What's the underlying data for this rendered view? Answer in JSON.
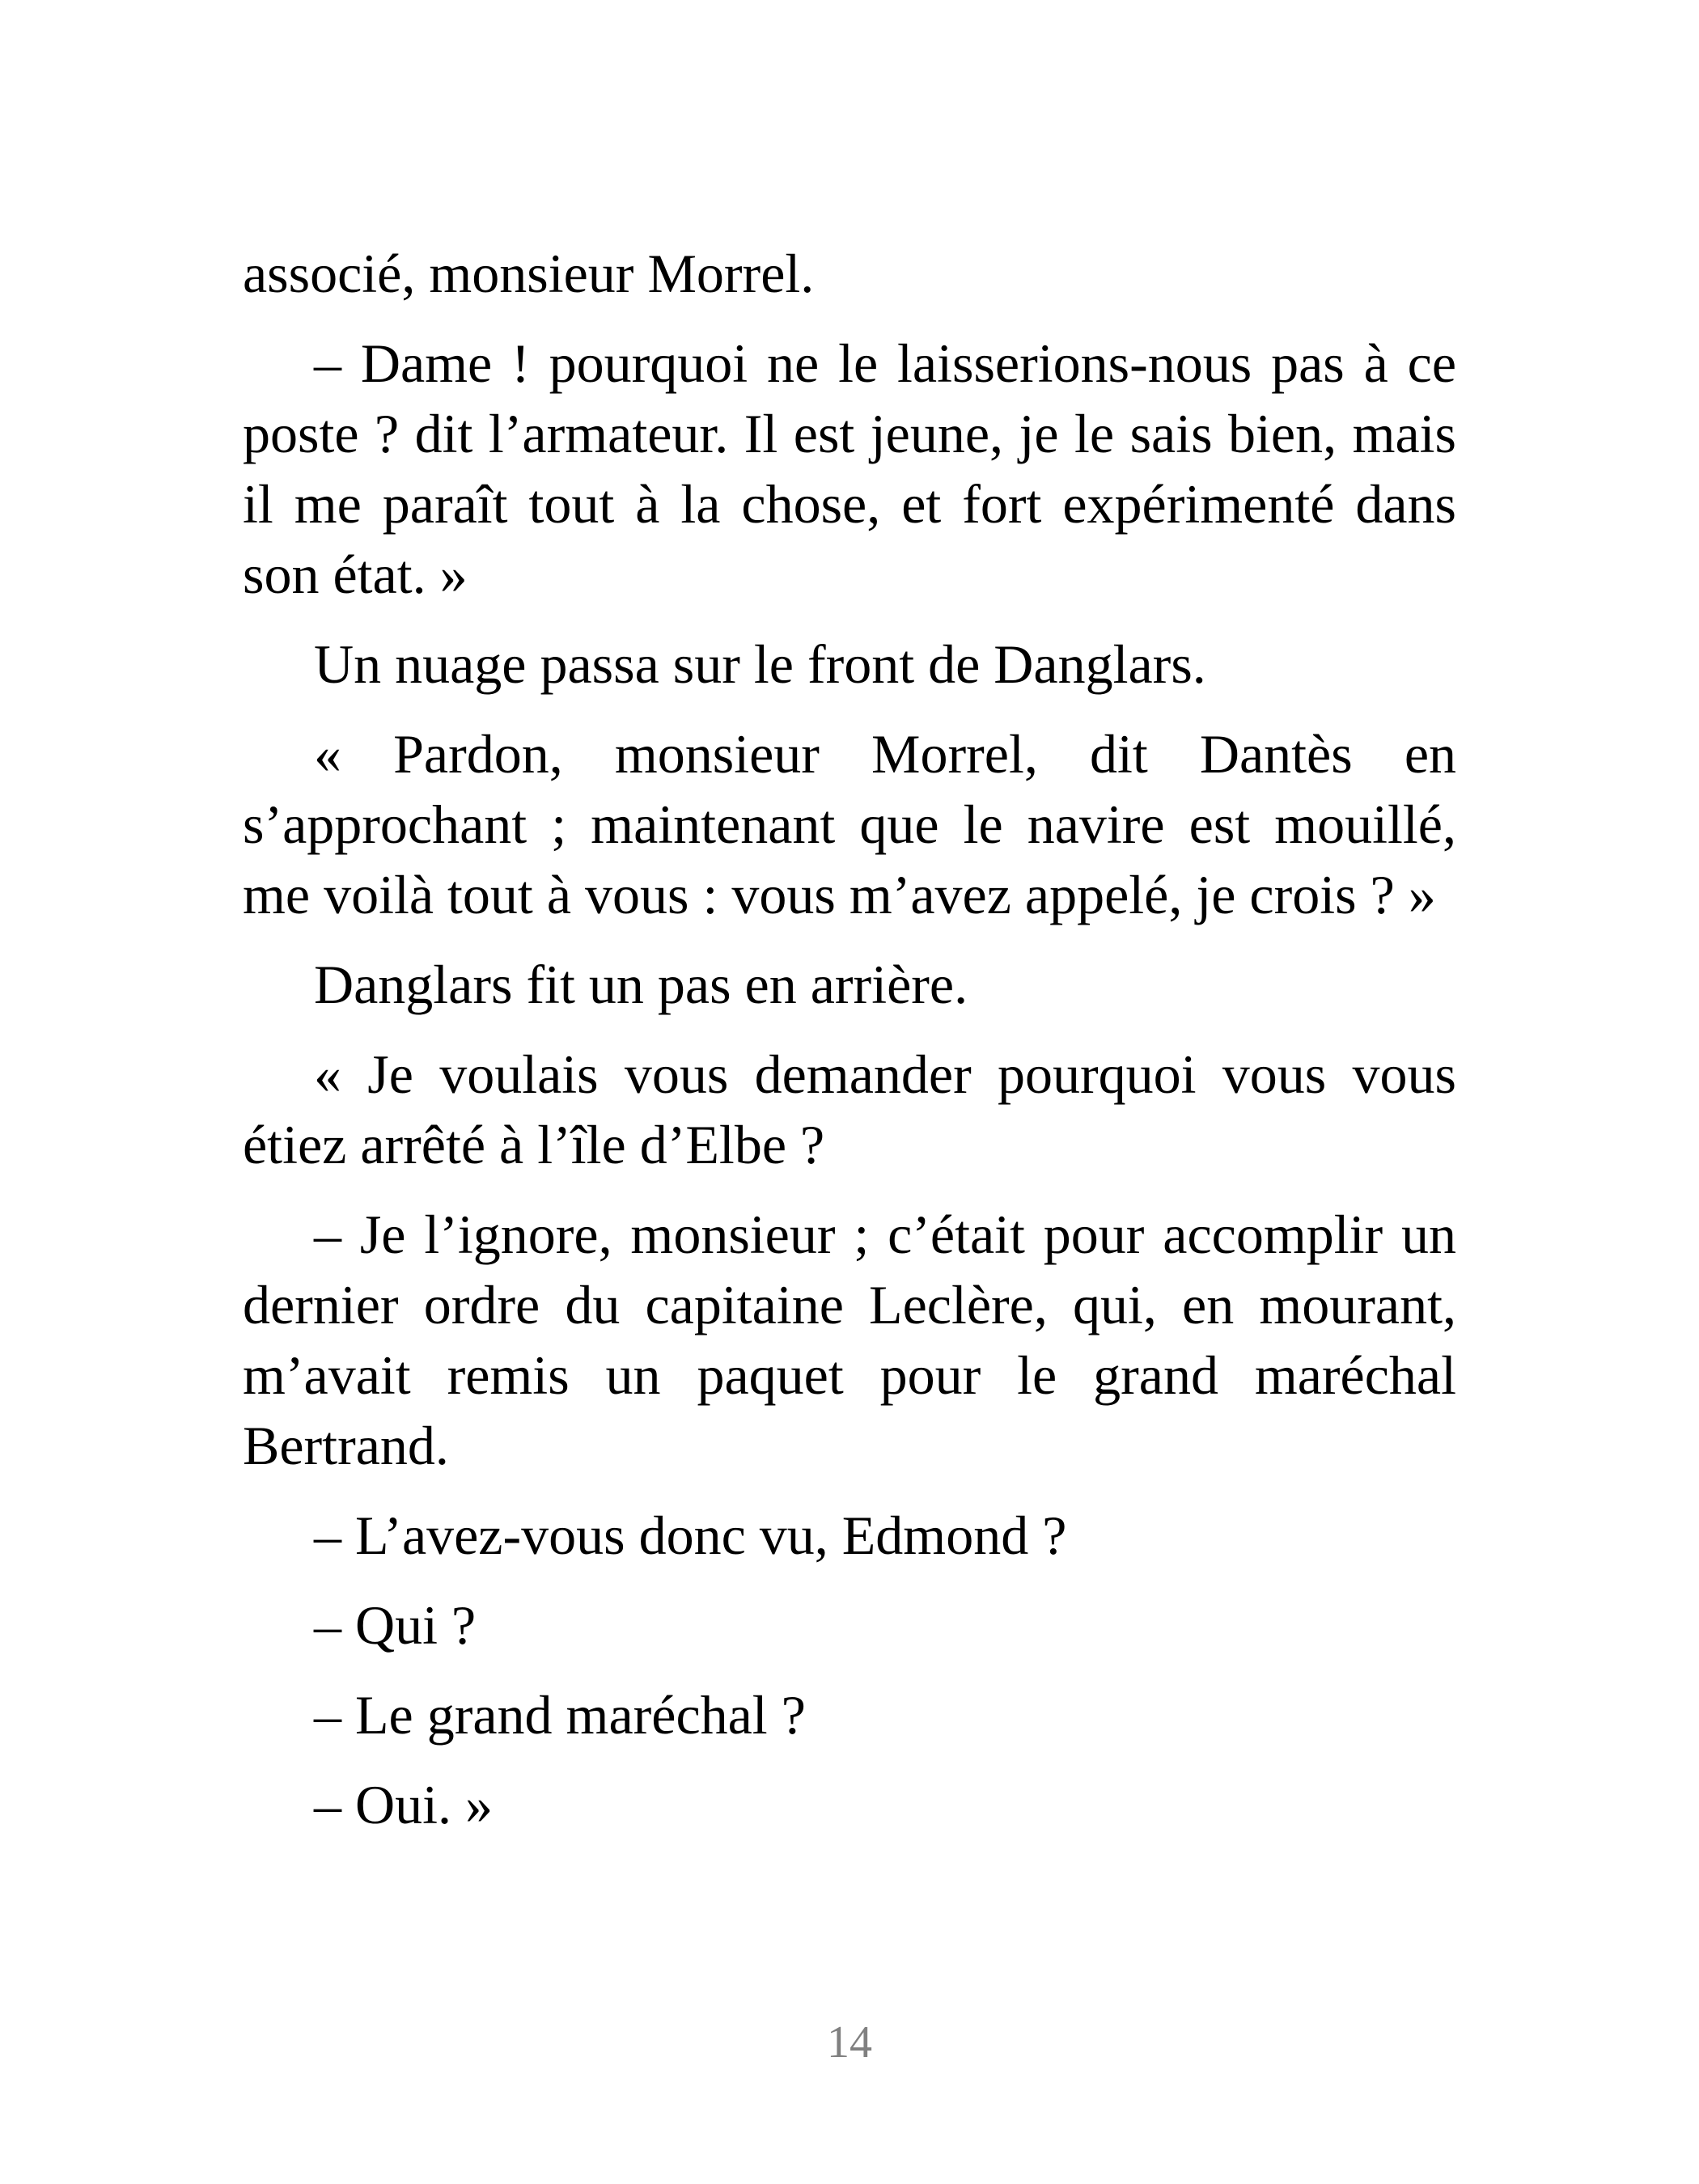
{
  "paragraphs": [
    {
      "text": "associé, monsieur Morrel.",
      "indent": false
    },
    {
      "text": "– Dame ! pourquoi ne le laisserions-nous pas à ce poste ? dit l’armateur. Il est jeune, je le sais bien, mais il me paraît tout à la chose, et fort expérimenté dans son état. »",
      "indent": true
    },
    {
      "text": "Un nuage passa sur le front de Danglars.",
      "indent": true
    },
    {
      "text": "« Pardon, monsieur Morrel, dit Dantès en s’approchant ; maintenant que le navire est mouillé, me voilà tout à vous : vous m’avez appelé, je crois ? »",
      "indent": true
    },
    {
      "text": "Danglars fit un pas en arrière.",
      "indent": true
    },
    {
      "text": "« Je voulais vous demander pourquoi vous vous étiez arrêté à l’île d’Elbe ?",
      "indent": true
    },
    {
      "text": "– Je l’ignore, monsieur ; c’était pour accomplir un dernier ordre du capitaine Leclère, qui, en mourant, m’avait remis un paquet pour le grand maréchal Bertrand.",
      "indent": true
    },
    {
      "text": "– L’avez-vous donc vu, Edmond ?",
      "indent": true
    },
    {
      "text": "– Qui ?",
      "indent": true
    },
    {
      "text": "– Le grand maréchal ?",
      "indent": true
    },
    {
      "text": "– Oui. »",
      "indent": true
    }
  ],
  "page_number": "14"
}
